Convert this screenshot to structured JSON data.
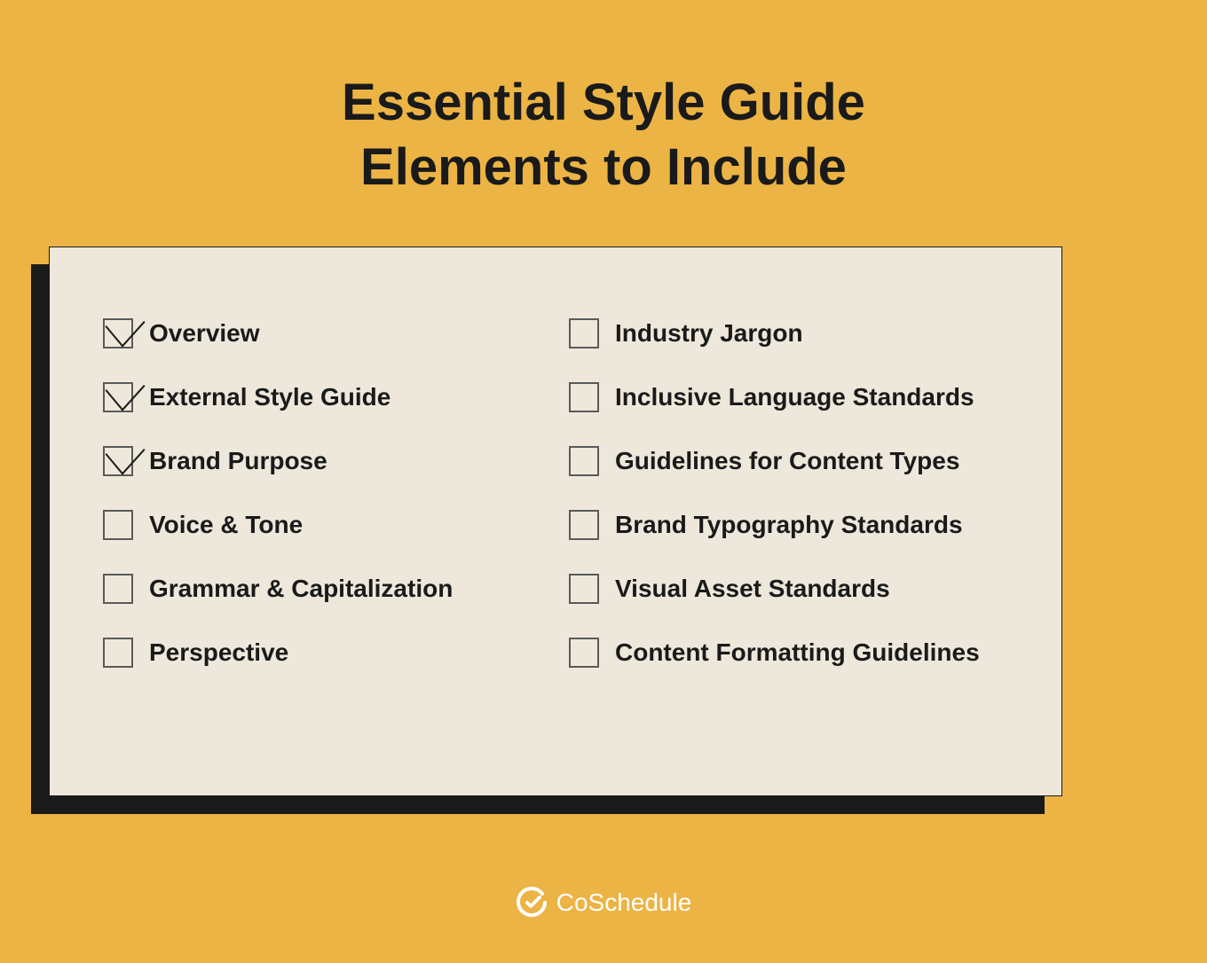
{
  "title_line1": "Essential Style Guide",
  "title_line2": "Elements to Include",
  "left_items": [
    {
      "label": "Overview",
      "checked": true
    },
    {
      "label": "External Style Guide",
      "checked": true
    },
    {
      "label": "Brand Purpose",
      "checked": true
    },
    {
      "label": "Voice & Tone",
      "checked": false
    },
    {
      "label": "Grammar & Capitalization",
      "checked": false
    },
    {
      "label": "Perspective",
      "checked": false
    }
  ],
  "right_items": [
    {
      "label": "Industry Jargon",
      "checked": false
    },
    {
      "label": "Inclusive Language Standards",
      "checked": false
    },
    {
      "label": "Guidelines for Content Types",
      "checked": false
    },
    {
      "label": "Brand Typography Standards",
      "checked": false
    },
    {
      "label": "Visual Asset Standards",
      "checked": false
    },
    {
      "label": "Content Formatting Guidelines",
      "checked": false
    }
  ],
  "footer_brand": "CoSchedule",
  "colors": {
    "background": "#ecb444",
    "card": "#ede8db",
    "text": "#1a1a1a",
    "footer_text": "#ffffff"
  }
}
